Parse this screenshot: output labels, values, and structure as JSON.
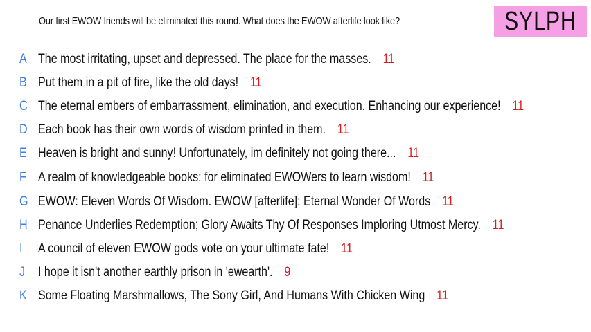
{
  "prompt": "Our first EWOW friends will be eliminated this round. What does the EWOW afterlife look like?",
  "contestant": "SYLPH",
  "colors": {
    "letter": "#3d7ee0",
    "score": "#d31e1e",
    "name_box": "#f5a0e4"
  },
  "responses": [
    {
      "letter": "A",
      "text": "The most irritating, upset and depressed. The place for the masses.",
      "score": "11"
    },
    {
      "letter": "B",
      "text": "Put them in a pit of fire, like the old days!",
      "score": "11"
    },
    {
      "letter": "C",
      "text": "The eternal embers of embarrassment, elimination, and execution. Enhancing our experience!",
      "score": "11"
    },
    {
      "letter": "D",
      "text": "Each book has their own words of wisdom printed in them.",
      "score": "11"
    },
    {
      "letter": "E",
      "text": "Heaven is bright and sunny! Unfortunately, im definitely not going there...",
      "score": "11"
    },
    {
      "letter": "F",
      "text": "A realm of knowledgeable books: for eliminated EWOWers to learn wisdom!",
      "score": "11"
    },
    {
      "letter": "G",
      "text": "EWOW: Eleven Words Of Wisdom. EWOW [afterlife]: Eternal Wonder Of Words",
      "score": "11"
    },
    {
      "letter": "H",
      "text": "Penance Underlies Redemption; Glory Awaits Thy Of Responses Imploring Utmost Mercy.",
      "score": "11"
    },
    {
      "letter": "I",
      "text": "A council of eleven EWOW gods vote on your ultimate fate!",
      "score": "11"
    },
    {
      "letter": "J",
      "text": "I hope it isn't another earthly prison in 'ewearth'.",
      "score": "9"
    },
    {
      "letter": "K",
      "text": "Some Floating Marshmallows, The Sony Girl, And Humans With Chicken Wing",
      "score": "11"
    }
  ]
}
